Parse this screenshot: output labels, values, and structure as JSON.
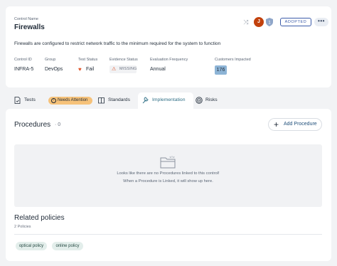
{
  "control": {
    "name_label": "Control Name",
    "name": "Firewalls",
    "description": "Firewalls are configured to restrict network traffic to the minimum required for the system to function",
    "avatar_initial": "J",
    "status_badge": "ADOPTED",
    "more_label": "•••"
  },
  "fields": {
    "control_id": {
      "label": "Control ID",
      "value": "INFRA-5"
    },
    "group": {
      "label": "Group",
      "value": "DevOps"
    },
    "test_status": {
      "label": "Test Status",
      "value": "Fail"
    },
    "evidence_status": {
      "label": "Evidence Status",
      "value": "MISSING"
    },
    "evaluation_frequency": {
      "label": "Evaluation Frequency",
      "value": "Annual"
    },
    "customers_impacted": {
      "label": "Customers Impacted",
      "value": "176"
    }
  },
  "tabs": [
    {
      "label": "Tests",
      "icon": "document-icon"
    },
    {
      "label": "Needs Attention",
      "icon": "alert-icon"
    },
    {
      "label": "Standards",
      "icon": "book-icon"
    },
    {
      "label": "Implementation",
      "icon": "tools-icon"
    },
    {
      "label": "Risks",
      "icon": "target-icon"
    }
  ],
  "active_tab": "Implementation",
  "procedures": {
    "title": "Procedures",
    "count": "· 0",
    "add_label": "Add Procedure",
    "empty_line1": "Looks like there are no Procedures linked to this control!",
    "empty_line2": "When a Procedure is Linked, it will show up here."
  },
  "related_policies": {
    "title": "Related policies",
    "count_label": "2 Policies",
    "items": [
      "optical policy",
      "online policy"
    ]
  },
  "colors": {
    "accent": "#3b5ba9",
    "fail": "#e0552b",
    "attention": "#f6c27a",
    "impact": "#8db4d6",
    "policy_pill": "#e3eeeb"
  }
}
